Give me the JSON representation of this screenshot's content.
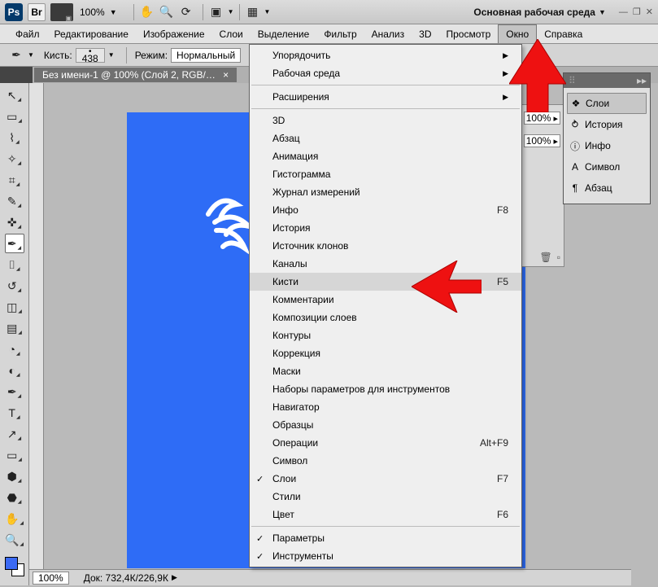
{
  "topbar": {
    "ps_badge": "Ps",
    "br_badge": "Br",
    "zoom": "100%",
    "workspace_label": "Основная рабочая среда"
  },
  "menubar": [
    "Файл",
    "Редактирование",
    "Изображение",
    "Слои",
    "Выделение",
    "Фильтр",
    "Анализ",
    "3D",
    "Просмотр",
    "Окно",
    "Справка"
  ],
  "options": {
    "brush_label": "Кисть:",
    "brush_size": "438",
    "mode_label": "Режим:",
    "mode_value": "Нормальный"
  },
  "document": {
    "title": "Без имени-1 @ 100% (Слой 2, RGB/…"
  },
  "window_menu": {
    "groups": [
      [
        {
          "label": "Упорядочить",
          "submenu": true
        },
        {
          "label": "Рабочая среда",
          "submenu": true
        }
      ],
      [
        {
          "label": "Расширения",
          "submenu": true
        }
      ],
      [
        {
          "label": "3D"
        },
        {
          "label": "Абзац"
        },
        {
          "label": "Анимация"
        },
        {
          "label": "Гистограмма"
        },
        {
          "label": "Журнал измерений"
        },
        {
          "label": "Инфо",
          "shortcut": "F8"
        },
        {
          "label": "История"
        },
        {
          "label": "Источник клонов"
        },
        {
          "label": "Каналы"
        },
        {
          "label": "Кисти",
          "shortcut": "F5",
          "highlighted": true
        },
        {
          "label": "Комментарии"
        },
        {
          "label": "Композиции слоев"
        },
        {
          "label": "Контуры"
        },
        {
          "label": "Коррекция"
        },
        {
          "label": "Маски"
        },
        {
          "label": "Наборы параметров для инструментов"
        },
        {
          "label": "Навигатор"
        },
        {
          "label": "Образцы"
        },
        {
          "label": "Операции",
          "shortcut": "Alt+F9"
        },
        {
          "label": "Символ"
        },
        {
          "label": "Слои",
          "shortcut": "F7",
          "checked": true
        },
        {
          "label": "Стили"
        },
        {
          "label": "Цвет",
          "shortcut": "F6"
        }
      ],
      [
        {
          "label": "Параметры",
          "checked": true
        },
        {
          "label": "Инструменты",
          "checked": true
        }
      ]
    ]
  },
  "panel": {
    "items": [
      {
        "icon": "layers-icon",
        "label": "Слои",
        "active": true
      },
      {
        "icon": "history-icon",
        "label": "История"
      },
      {
        "icon": "info-icon",
        "label": "Инфо"
      },
      {
        "icon": "character-icon",
        "label": "Символ"
      },
      {
        "icon": "paragraph-icon",
        "label": "Абзац"
      }
    ]
  },
  "bgpanel": {
    "pct1": "100%",
    "pct2": "100%"
  },
  "status": {
    "zoom": "100%",
    "doc_info": "Док: 732,4К/226,9К"
  },
  "tools": [
    "move",
    "marquee",
    "lasso",
    "wand",
    "crop",
    "eyedropper",
    "heal",
    "brush-active",
    "stamp",
    "history-brush",
    "eraser",
    "gradient",
    "blur",
    "dodge",
    "pen",
    "type",
    "path",
    "shape",
    "3d",
    "3dview",
    "hand",
    "zoom"
  ]
}
